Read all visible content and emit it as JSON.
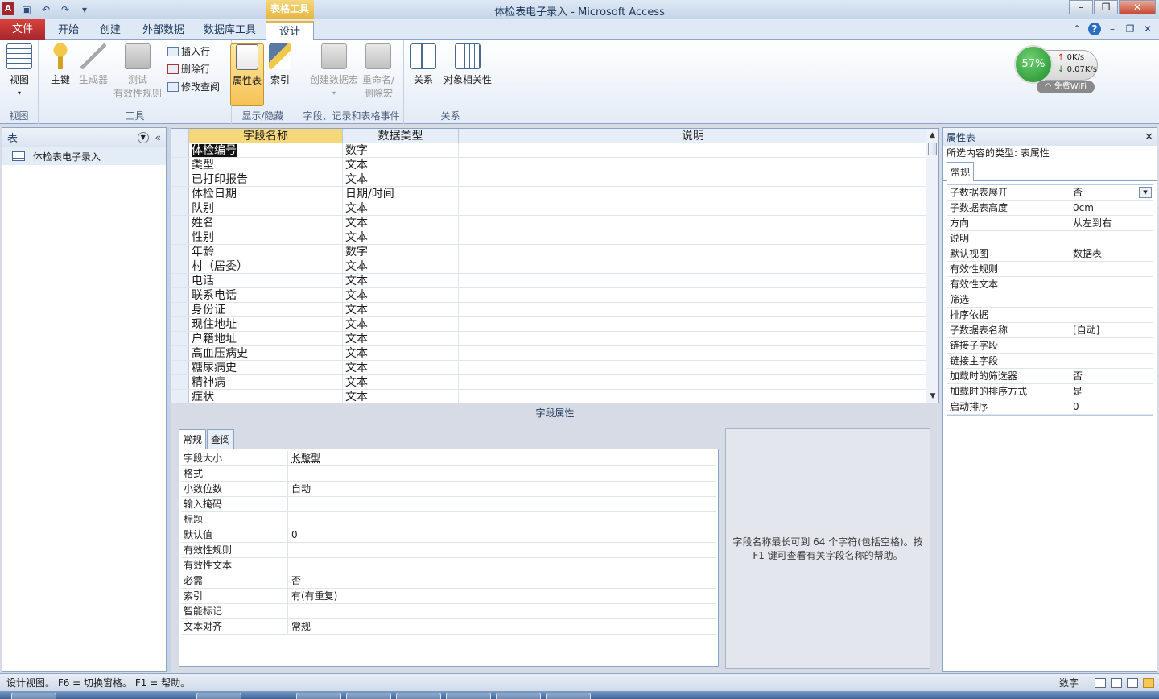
{
  "window": {
    "title": "体检表电子录入  -  Microsoft Access",
    "context_tab_label": "表格工具",
    "app_icon": "A"
  },
  "ribbon_tabs": [
    "文件",
    "开始",
    "创建",
    "外部数据",
    "数据库工具",
    "设计"
  ],
  "ribbon": {
    "groups": {
      "view": "视图",
      "tools": "工具",
      "showhide": "显示/隐藏",
      "events": "字段、记录和表格事件",
      "relations": "关系"
    },
    "buttons": {
      "view": "视图",
      "primary_key": "主键",
      "builder": "生成器",
      "test_rules_1": "测试",
      "test_rules_2": "有效性规则",
      "insert_rows": "插入行",
      "delete_rows": "删除行",
      "modify_lookups": "修改查阅",
      "property_sheet": "属性表",
      "indexes": "索引",
      "create_macro": "创建数据宏",
      "rename_macro_1": "重命名/",
      "rename_macro_2": "删除宏",
      "relationships": "关系",
      "object_dependencies": "对象相关性"
    }
  },
  "network_widget": {
    "percent": "57%",
    "upload": "0K/s",
    "download": "0.07K/s",
    "wifi_label": "免费WiFi"
  },
  "nav_pane": {
    "header": "表",
    "items": [
      "体检表电子录入"
    ]
  },
  "design_grid": {
    "columns": [
      "字段名称",
      "数据类型",
      "说明"
    ],
    "rows": [
      {
        "name": "体检编号",
        "type": "数字"
      },
      {
        "name": "类型",
        "type": "文本"
      },
      {
        "name": "已打印报告",
        "type": "文本"
      },
      {
        "name": "体检日期",
        "type": "日期/时间"
      },
      {
        "name": "队别",
        "type": "文本"
      },
      {
        "name": "姓名",
        "type": "文本"
      },
      {
        "name": "性别",
        "type": "文本"
      },
      {
        "name": "年龄",
        "type": "数字"
      },
      {
        "name": "村（居委）",
        "type": "文本"
      },
      {
        "name": "电话",
        "type": "文本"
      },
      {
        "name": "联系电话",
        "type": "文本"
      },
      {
        "name": "身份证",
        "type": "文本"
      },
      {
        "name": "现住地址",
        "type": "文本"
      },
      {
        "name": "户籍地址",
        "type": "文本"
      },
      {
        "name": "高血压病史",
        "type": "文本"
      },
      {
        "name": "糖尿病史",
        "type": "文本"
      },
      {
        "name": "精神病",
        "type": "文本"
      },
      {
        "name": "症状",
        "type": "文本"
      }
    ]
  },
  "field_properties": {
    "title": "字段属性",
    "tabs": [
      "常规",
      "查阅"
    ],
    "rows": [
      {
        "k": "字段大小",
        "v": "长整型"
      },
      {
        "k": "格式",
        "v": ""
      },
      {
        "k": "小数位数",
        "v": "自动"
      },
      {
        "k": "输入掩码",
        "v": ""
      },
      {
        "k": "标题",
        "v": ""
      },
      {
        "k": "默认值",
        "v": "0"
      },
      {
        "k": "有效性规则",
        "v": ""
      },
      {
        "k": "有效性文本",
        "v": ""
      },
      {
        "k": "必需",
        "v": "否"
      },
      {
        "k": "索引",
        "v": "有(有重复)"
      },
      {
        "k": "智能标记",
        "v": ""
      },
      {
        "k": "文本对齐",
        "v": "常规"
      }
    ],
    "help_text": "字段名称最长可到 64 个字符(包括空格)。按 F1 键可查看有关字段名称的帮助。"
  },
  "property_sheet": {
    "title": "属性表",
    "subtitle": "所选内容的类型: 表属性",
    "tab": "常规",
    "rows": [
      {
        "k": "子数据表展开",
        "v": "否"
      },
      {
        "k": "子数据表高度",
        "v": "0cm"
      },
      {
        "k": "方向",
        "v": "从左到右"
      },
      {
        "k": "说明",
        "v": ""
      },
      {
        "k": "默认视图",
        "v": "数据表"
      },
      {
        "k": "有效性规则",
        "v": ""
      },
      {
        "k": "有效性文本",
        "v": ""
      },
      {
        "k": "筛选",
        "v": ""
      },
      {
        "k": "排序依据",
        "v": ""
      },
      {
        "k": "子数据表名称",
        "v": "[自动]"
      },
      {
        "k": "链接子字段",
        "v": ""
      },
      {
        "k": "链接主字段",
        "v": ""
      },
      {
        "k": "加载时的筛选器",
        "v": "否"
      },
      {
        "k": "加载时的排序方式",
        "v": "是"
      },
      {
        "k": "启动排序",
        "v": "0"
      }
    ]
  },
  "statusbar": {
    "text": "设计视图。  F6 = 切换窗格。  F1 = 帮助。",
    "mode": "数字"
  }
}
